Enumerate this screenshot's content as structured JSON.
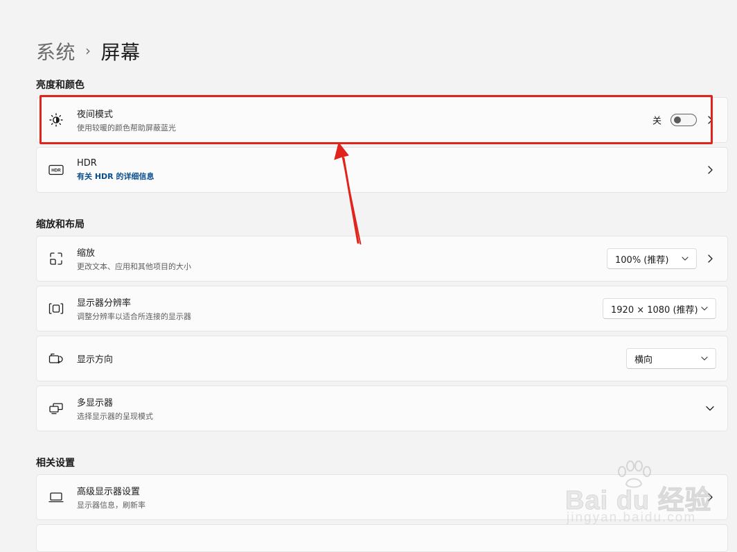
{
  "breadcrumb": {
    "parent": "系统",
    "separator": "›",
    "current": "屏幕"
  },
  "sections": {
    "brightness_color": "亮度和颜色",
    "scale_layout": "缩放和布局",
    "related": "相关设置"
  },
  "night_light": {
    "title": "夜间模式",
    "subtitle": "使用较暖的颜色帮助屏蔽蓝光",
    "toggle_state_label": "关",
    "toggle_on": false,
    "icon": "night-light-icon"
  },
  "hdr": {
    "title": "HDR",
    "link": "有关 HDR 的详细信息",
    "icon": "hdr-icon"
  },
  "scale": {
    "title": "缩放",
    "subtitle": "更改文本、应用和其他项目的大小",
    "value": "100% (推荐)",
    "icon": "scale-icon"
  },
  "resolution": {
    "title": "显示器分辨率",
    "subtitle": "调整分辨率以适合所连接的显示器",
    "value": "1920 × 1080 (推荐)",
    "icon": "resolution-icon"
  },
  "orientation": {
    "title": "显示方向",
    "value": "横向",
    "icon": "orientation-icon"
  },
  "multi_display": {
    "title": "多显示器",
    "subtitle": "选择显示器的呈现模式",
    "icon": "multi-display-icon"
  },
  "advanced_display": {
    "title": "高级显示器设置",
    "subtitle": "显示器信息，刷新率",
    "icon": "laptop-icon"
  },
  "watermark": {
    "main": "Bai du 经验",
    "sub": "jingyan.baidu.com"
  },
  "colors": {
    "accent_link": "#0a4d8f",
    "annotation_red": "#e0241b",
    "background": "#f3f3f3",
    "card": "#fbfbfb"
  }
}
